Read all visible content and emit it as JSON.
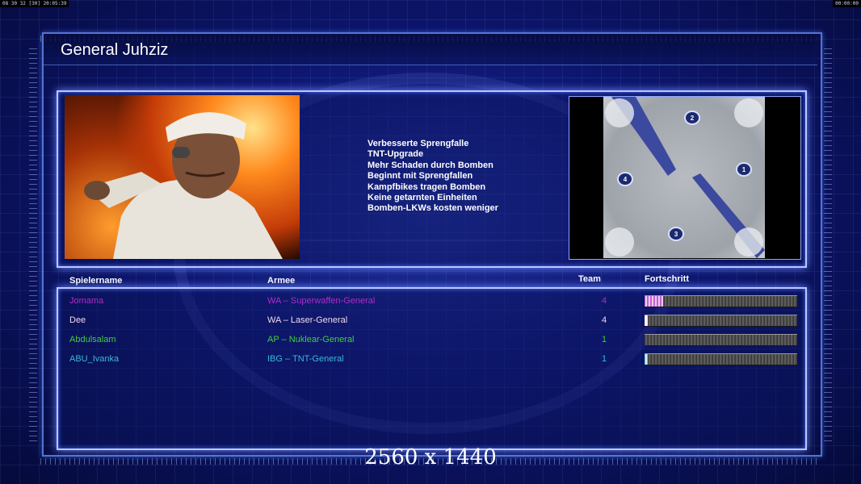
{
  "topbar": {
    "left_text": "08 30 32 [30] 20:05:39",
    "right_text": "00:00:00"
  },
  "title": "General Juhziz",
  "portrait_icon": "general-portrait",
  "bonuses": [
    "Verbesserte Sprengfalle",
    "TNT-Upgrade",
    "Mehr Schaden durch Bomben",
    "Beginnt mit Sprengfallen",
    "Kampfbikes tragen Bomben",
    "Keine getarnten Einheiten",
    "Bomben-LKWs kosten weniger"
  ],
  "map": {
    "markers": [
      "2",
      "4",
      "1",
      "3"
    ]
  },
  "columns": {
    "name": "Spielername",
    "army": "Armee",
    "team": "Team",
    "progress": "Fortschritt"
  },
  "players": [
    {
      "name": "Jomama",
      "army": "WA – Superwaffen-General",
      "team": "4",
      "color": "#b02cc8",
      "progress": 0.12
    },
    {
      "name": "Dee",
      "army": "WA – Laser-General",
      "team": "4",
      "color": "#f2d8ee",
      "progress": 0.02
    },
    {
      "name": "Abdulsalam",
      "army": "AP – Nuklear-General",
      "team": "1",
      "color": "#3fcf3c",
      "progress": 0.0
    },
    {
      "name": "ABU_Ivanka",
      "army": "IBG – TNT-General",
      "team": "1",
      "color": "#3bb8d6",
      "progress": 0.02
    }
  ],
  "resolution": "2560 x 1440"
}
